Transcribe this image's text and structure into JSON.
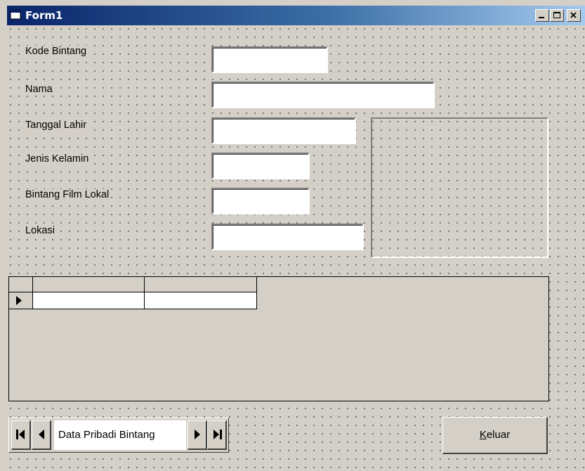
{
  "window": {
    "title": "Form1"
  },
  "labels": {
    "kode": "Kode Bintang",
    "nama": "Nama",
    "tanggal": "Tanggal Lahir",
    "jenis": "Jenis Kelamin",
    "film": "Bintang Film Lokal",
    "lokasi": "Lokasi"
  },
  "fields": {
    "kode": "",
    "nama": "",
    "tanggal": "",
    "jenis": "",
    "film": "",
    "lokasi": ""
  },
  "data_control": {
    "caption": "Data Pribadi Bintang"
  },
  "buttons": {
    "keluar_accel": "K",
    "keluar_rest": "eluar"
  },
  "icons": [
    "form-icon",
    "minimize-icon",
    "maximize-icon",
    "close-icon",
    "first-record-icon",
    "previous-record-icon",
    "next-record-icon",
    "last-record-icon",
    "record-pointer-icon"
  ]
}
